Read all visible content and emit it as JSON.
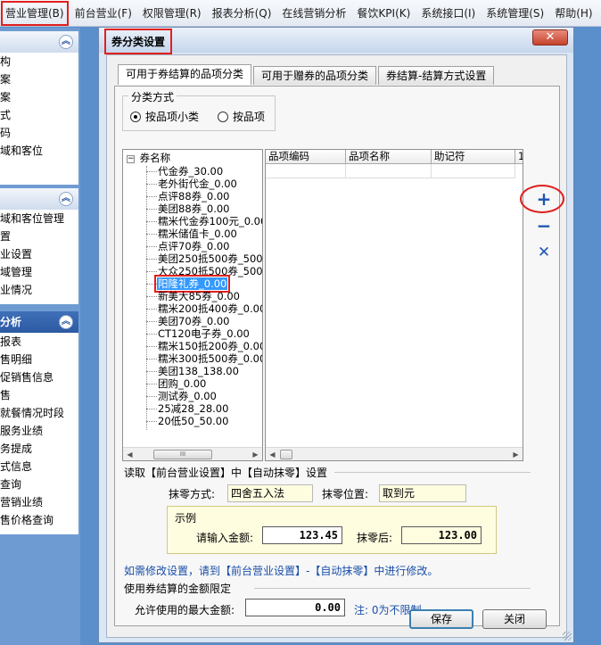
{
  "menubar": {
    "items": [
      "营业管理(B)",
      "前台营业(F)",
      "权限管理(R)",
      "报表分析(Q)",
      "在线营销分析",
      "餐饮KPI(K)",
      "系统接口(I)",
      "系统管理(S)",
      "帮助(H)"
    ]
  },
  "leftnav": {
    "section1": {
      "collapse_glyph": "︽",
      "items": [
        "构",
        "案",
        "案",
        "式",
        "码",
        "域和客位"
      ]
    },
    "section2": {
      "collapse_glyph": "︽",
      "items": [
        "域和客位管理",
        "置",
        "业设置",
        "域管理",
        "业情况"
      ]
    },
    "section3": {
      "title": "分析",
      "collapse_glyph": "︽",
      "items": [
        "报表",
        "售明细",
        "促销售信息",
        "售",
        "就餐情况时段",
        "服务业绩",
        "务提成",
        "式信息",
        "查询",
        "营销业绩",
        "售价格查询"
      ]
    }
  },
  "dialog": {
    "title": "券分类设置",
    "close_glyph": "✕",
    "tabs": [
      "可用于券结算的品项分类",
      "可用于赠券的品项分类",
      "券结算-结算方式设置"
    ],
    "classify": {
      "legend": "分类方式",
      "option_minor": "按品项小类",
      "option_item": "按品项"
    },
    "tree": {
      "root_toggle": "−",
      "root": "券名称",
      "nodes": [
        "代金券_30.00",
        "老外街代金_0.00",
        "点评88券_0.00",
        "美团88券_0.00",
        "糯米代金券100元_0.00",
        "糯米储值卡_0.00",
        "点评70券_0.00",
        "美团250抵500券_500.00",
        "大众250抵500券_500.00",
        "阳隆礼券_0.00",
        "新美大85券_0.00",
        "糯米200抵400券_0.00",
        "美团70券_0.00",
        "CT120电子券_0.00",
        "糯米150抵200券_0.00",
        "糯米300抵500券_0.00",
        "美团138_138.00",
        "团购_0.00",
        "测试券_0.00",
        "25减28_28.00",
        "20低50_50.00"
      ],
      "selected_index": 9,
      "scroll_left": "◀",
      "scroll_right": "▶",
      "thumb_grip": "III"
    },
    "grid": {
      "headers": [
        "品项编码",
        "品项名称",
        "助记符",
        "1"
      ],
      "scroll_left": "◀",
      "scroll_right": "▶"
    },
    "side_buttons": {
      "add": "+",
      "remove": "−",
      "delete": "✕"
    },
    "rounding": {
      "section_title": "读取【前台营业设置】中【自动抹零】设置",
      "mode_label": "抹零方式:",
      "mode_value": "四舍五入法",
      "position_label": "抹零位置:",
      "position_value": "取到元"
    },
    "example": {
      "title": "示例",
      "input_label": "请输入金额:",
      "input_value": "123.45",
      "after_label": "抹零后:",
      "after_value": "123.00"
    },
    "hint": "如需修改设置，请到【前台营业设置】-【自动抹零】中进行修改。",
    "limit": {
      "section_title": "使用券结算的金额限定",
      "max_label": "允许使用的最大金额:",
      "max_value": "0.00",
      "note": "注: 0为不限制"
    },
    "buttons": {
      "save": "保存",
      "close": "关闭"
    }
  }
}
